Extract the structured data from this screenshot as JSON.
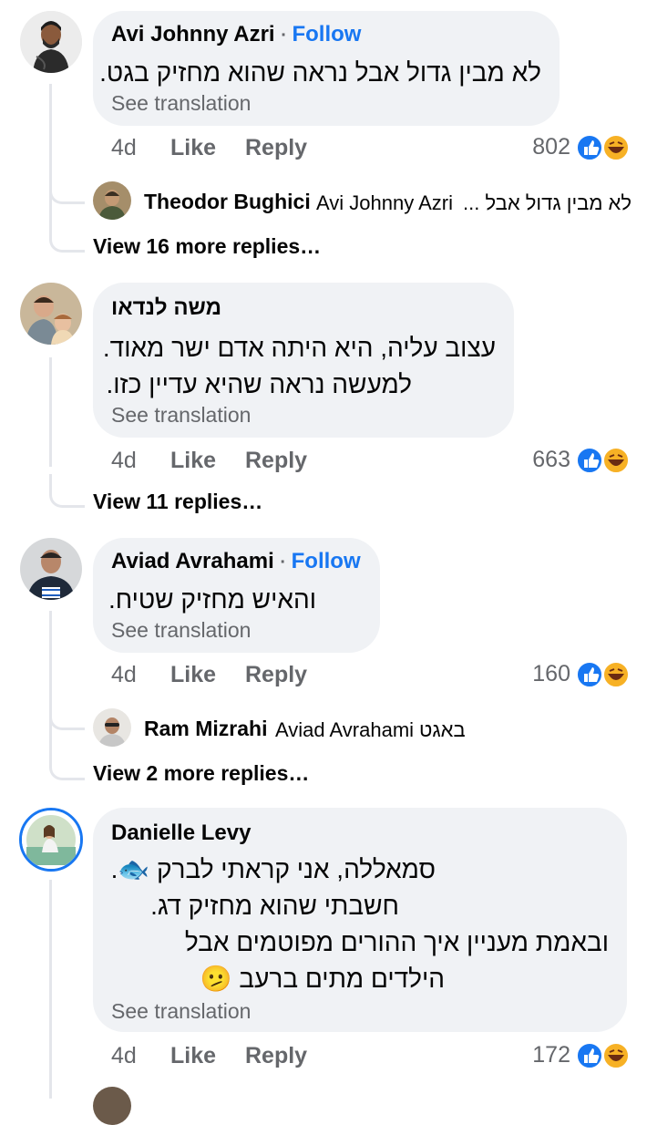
{
  "comments": [
    {
      "author": "Avi Johnny Azri",
      "follow": "Follow",
      "lines": [
        "לא מבין גדול אבל נראה שהוא מחזיק בגט."
      ],
      "see_translation": "See translation",
      "time": "4d",
      "like": "Like",
      "reply": "Reply",
      "reactions": "802",
      "reply_preview": {
        "author": "Theodor Bughici",
        "mention": "Avi Johnny Azri",
        "text": "לא מבין גדול אבל ..."
      },
      "view_replies": "View 16 more replies…"
    },
    {
      "author": "משה לנדאו",
      "lines": [
        "עצוב עליה, היא היתה אדם ישר מאוד.",
        "למעשה נראה שהיא עדיין כזו."
      ],
      "see_translation": "See translation",
      "time": "4d",
      "like": "Like",
      "reply": "Reply",
      "reactions": "663",
      "view_replies": "View 11 replies…"
    },
    {
      "author": "Aviad Avrahami",
      "follow": "Follow",
      "lines": [
        "והאיש מחזיק שטיח."
      ],
      "see_translation": "See translation",
      "time": "4d",
      "like": "Like",
      "reply": "Reply",
      "reactions": "160",
      "reply_preview": {
        "author": "Ram Mizrahi",
        "mention": "Aviad Avrahami",
        "text": "באגט"
      },
      "view_replies": "View 2 more replies…"
    },
    {
      "author": "Danielle Levy",
      "lines": [
        "סמאללה, אני קראתי לברק 🐟.",
        "חשבתי שהוא מחזיק דג.",
        "ובאמת מעניין איך ההורים מפוטמים אבל",
        "הילדים מתים ברעב 🫤"
      ],
      "see_translation": "See translation",
      "time": "4d",
      "like": "Like",
      "reply": "Reply",
      "reactions": "172"
    }
  ],
  "colors": {
    "like_blue": "#1877f2",
    "haha_yellow": "#f7b125",
    "bubble": "#f0f2f5",
    "secondary": "#65676b"
  }
}
